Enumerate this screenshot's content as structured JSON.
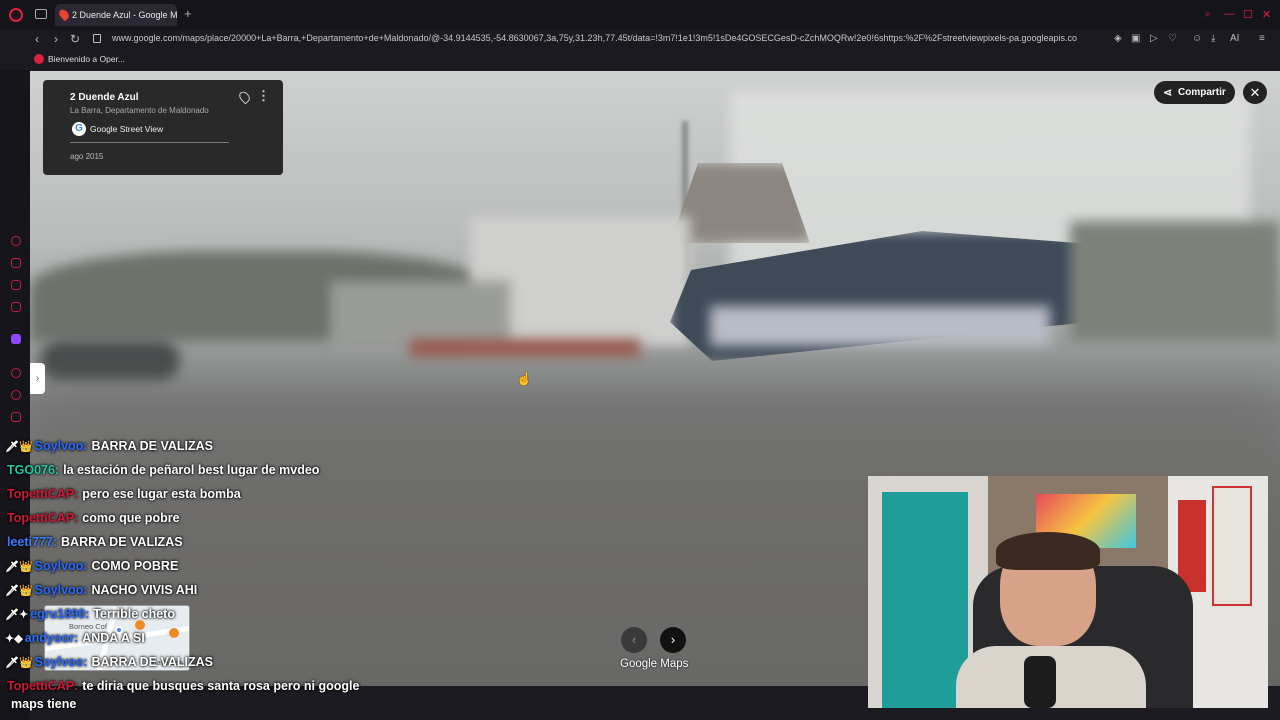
{
  "browser": {
    "tab_title": "2 Duende Azul - Google M",
    "url": "www.google.com/maps/place/20000+La+Barra,+Departamento+de+Maldonado/@-34.9144535,-54.8630067,3a,75y,31.23h,77.45t/data=!3m7!1e1!3m5!1sDe4GOSECGesD-cZchMOQRw!2e0!6shttps:%2F%2Fstreetviewpixels-pa.googleapis.co",
    "bookmark": "Bienvenido a Oper...",
    "ai_label": "AI"
  },
  "infocard": {
    "title": "2 Duende Azul",
    "subtitle": "La Barra, Departamento de Maldonado",
    "source": "Google Street View",
    "date": "ago 2015"
  },
  "controls": {
    "share_label": "Compartir",
    "close_symbol": "✕",
    "prev_symbol": "‹",
    "next_symbol": "›",
    "toggle_symbol": "›",
    "brand": "Google Maps"
  },
  "chat": [
    {
      "user": "Soylvoo:",
      "color": "#2a6cff",
      "badges": "🗡👑",
      "message": "BARRA DE VALIZAS"
    },
    {
      "user": "TGO076:",
      "color": "#1ec8a0",
      "badges": "",
      "message": "la estación de peñarol best lugar de mvdeo"
    },
    {
      "user": "TopettiCAP:",
      "color": "#d01838",
      "badges": "",
      "message": "pero ese lugar esta bomba"
    },
    {
      "user": "TopettiCAP:",
      "color": "#d01838",
      "badges": "",
      "message": "como que pobre"
    },
    {
      "user": "leeti777:",
      "color": "#3a7cff",
      "badges": "",
      "message": "BARRA DE VALIZAS"
    },
    {
      "user": "Soylvoo:",
      "color": "#2a6cff",
      "badges": "🗡👑",
      "message": "COMO POBRE"
    },
    {
      "user": "Soylvoo:",
      "color": "#2a6cff",
      "badges": "🗡👑",
      "message": "NACHO VIVIS AHI"
    },
    {
      "user": "egru1890:",
      "color": "#2a6cff",
      "badges": "🗡✦",
      "message": "Terrible cheto"
    },
    {
      "user": "andyoor:",
      "color": "#2a6cff",
      "badges": "✦◆",
      "message": "ANDA A SI"
    },
    {
      "user": "Soylvoo:",
      "color": "#2a6cff",
      "badges": "🗡👑",
      "message": "BARRA DE VALIZAS"
    },
    {
      "user": "TopettiCAP:",
      "color": "#d01838",
      "badges": "",
      "message": "te diria que busques santa rosa pero ni google"
    },
    {
      "user": "",
      "color": "#ffffff",
      "badges": "",
      "message": "maps tiene"
    }
  ],
  "minimap": {
    "label1": "Borneo Cof",
    "label2": "Playa Los"
  },
  "colors": {
    "accent": "#e02040",
    "dark_panel": "#222222"
  }
}
